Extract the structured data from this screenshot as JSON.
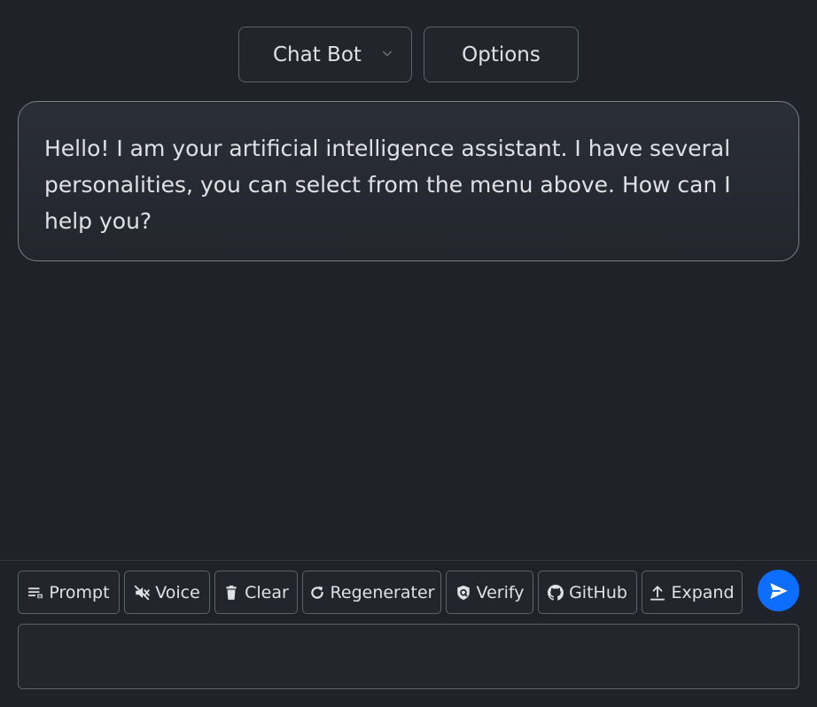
{
  "header": {
    "personality_select": {
      "selected": "Chat Bot",
      "icon": "chevron-down-icon"
    },
    "options_label": "Options"
  },
  "messages": [
    {
      "role": "assistant",
      "text": "Hello! I am your artificial intelligence assistant. I have several personalities, you can select from the menu above. How can I help you?"
    }
  ],
  "toolbar": {
    "buttons": [
      {
        "label": "Prompt",
        "icon": "prompt-list-icon"
      },
      {
        "label": "Voice",
        "icon": "volume-mute-icon"
      },
      {
        "label": "Clear",
        "icon": "trash-icon"
      },
      {
        "label": "Regenerater",
        "icon": "refresh-icon"
      },
      {
        "label": "Verify",
        "icon": "shield-check-icon"
      },
      {
        "label": "GitHub",
        "icon": "github-icon"
      },
      {
        "label": "Expand",
        "icon": "upload-expand-icon"
      }
    ],
    "send_icon": "send-icon"
  },
  "input": {
    "value": "",
    "placeholder": ""
  },
  "colors": {
    "background": "#1f2228",
    "border": "#5c636a",
    "text": "#dee2e6",
    "accent": "#0d6efd"
  }
}
